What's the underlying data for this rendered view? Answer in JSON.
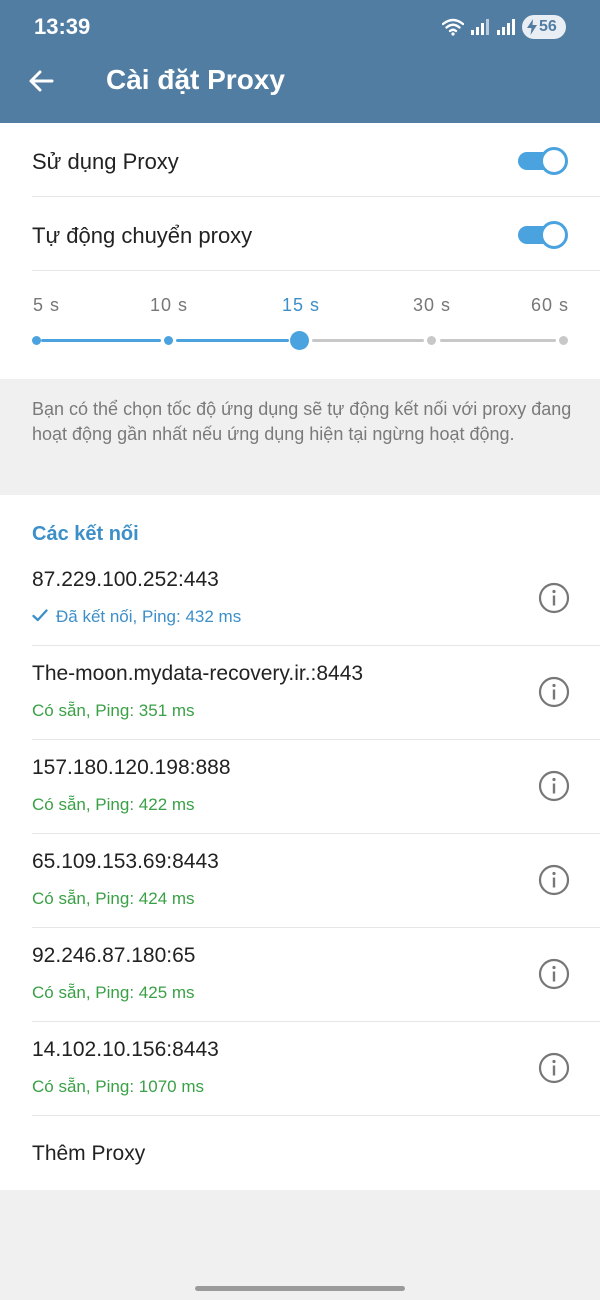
{
  "status_bar": {
    "time": "13:39",
    "battery": "56",
    "icons": [
      "wifi-icon",
      "signal-icon",
      "signal-icon",
      "battery-charging-icon"
    ]
  },
  "header": {
    "title": "Cài đặt Proxy",
    "back_icon": "arrow-left-icon",
    "color": "#527da3"
  },
  "settings": {
    "use_proxy": {
      "label": "Sử dụng Proxy",
      "enabled": true
    },
    "auto_switch": {
      "label": "Tự động chuyển proxy",
      "enabled": true
    },
    "interval": {
      "options": [
        "5 s",
        "10 s",
        "15 s",
        "30 s",
        "60 s"
      ],
      "selected_index": 2,
      "selected": "15 s"
    },
    "hint": "Bạn có thể chọn tốc độ ứng dụng sẽ tự động kết nối với proxy đang hoạt động gần nhất nếu ứng dụng hiện tại ngừng hoạt động."
  },
  "connections": {
    "title": "Các kết nối",
    "items": [
      {
        "address": "87.229.100.252:443",
        "status": "Đã kết nối, Ping: 432 ms",
        "connected": true
      },
      {
        "address": "The-moon.mydata-recovery.ir.:8443",
        "status": "Có sẵn, Ping: 351 ms",
        "connected": false
      },
      {
        "address": "157.180.120.198:888",
        "status": "Có sẵn, Ping: 422 ms",
        "connected": false
      },
      {
        "address": "65.109.153.69:8443",
        "status": "Có sẵn, Ping: 424 ms",
        "connected": false
      },
      {
        "address": "92.246.87.180:65",
        "status": "Có sẵn, Ping: 425 ms",
        "connected": false
      },
      {
        "address": "14.102.10.156:8443",
        "status": "Có sẵn, Ping: 1070 ms",
        "connected": false
      }
    ],
    "add_label": "Thêm Proxy"
  },
  "colors": {
    "accent": "#4aa3df",
    "available": "#3aa046",
    "connected": "#3d8fc9",
    "inactive_track": "#c8c8c8"
  }
}
